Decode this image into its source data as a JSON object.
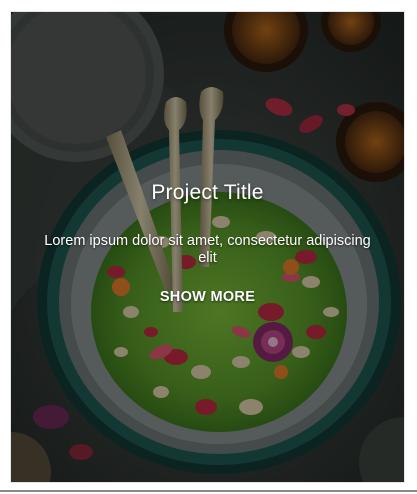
{
  "card": {
    "title": "Project Title",
    "description": "Lorem ipsum dolor sit amet, consectetur adipiscing elit",
    "action_label": "SHOW MORE"
  },
  "colors": {
    "overlay": "#000000",
    "text": "#ffffff",
    "salad": "#5f9a2c",
    "bowl_rim": "#1f5a52"
  },
  "image": {
    "alt": "",
    "icon": "food-photo"
  }
}
